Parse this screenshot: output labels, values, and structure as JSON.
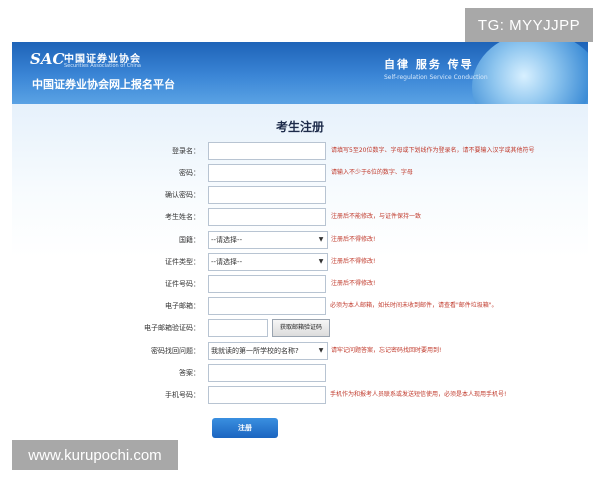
{
  "watermark_top": "TG: MYYJJPP",
  "watermark_bottom": "www.kurupochi.com",
  "header": {
    "logo_mark": "SAC",
    "logo_cn": "中国证券业协会",
    "logo_en": "Securities Association of China",
    "site_title": "中国证券业协会网上报名平台",
    "slogan_cn": "自律  服务  传导",
    "slogan_en": "Self-regulation   Service   Conduction"
  },
  "page_title": "考生注册",
  "form": {
    "username": {
      "label": "登录名：",
      "hint": "请填写5至20位数字、字母或下划线作为登录名，请不要输入汉字或其他符号"
    },
    "password": {
      "label": "密码：",
      "hint": "请输入不少于6位的数字、字母"
    },
    "confirm_password": {
      "label": "确认密码："
    },
    "name": {
      "label": "考生姓名：",
      "hint": "注册后不能修改，与证件保持一致"
    },
    "nationality": {
      "label": "国籍：",
      "value": "--请选择--",
      "hint": "注册后不得修改!"
    },
    "id_type": {
      "label": "证件类型：",
      "value": "--请选择--",
      "hint": "注册后不得修改!"
    },
    "id_number": {
      "label": "证件号码：",
      "hint": "注册后不得修改!"
    },
    "email": {
      "label": "电子邮箱：",
      "hint": "必须为本人邮箱，如长时间未收到邮件，请查看\"邮件垃圾箱\"。"
    },
    "email_code": {
      "label": "电子邮箱验证码：",
      "button": "获取邮箱验证码"
    },
    "security_question": {
      "label": "密码找回问题：",
      "value": "我就读的第一所学校的名称?",
      "hint": "请牢记问题答案，忘记密码找回时要用到!"
    },
    "answer": {
      "label": "答案："
    },
    "phone": {
      "label": "手机号码：",
      "hint": "手机作为和报考人员联系或发送短信使用，必须是本人现用手机号!"
    },
    "submit": "注册"
  }
}
